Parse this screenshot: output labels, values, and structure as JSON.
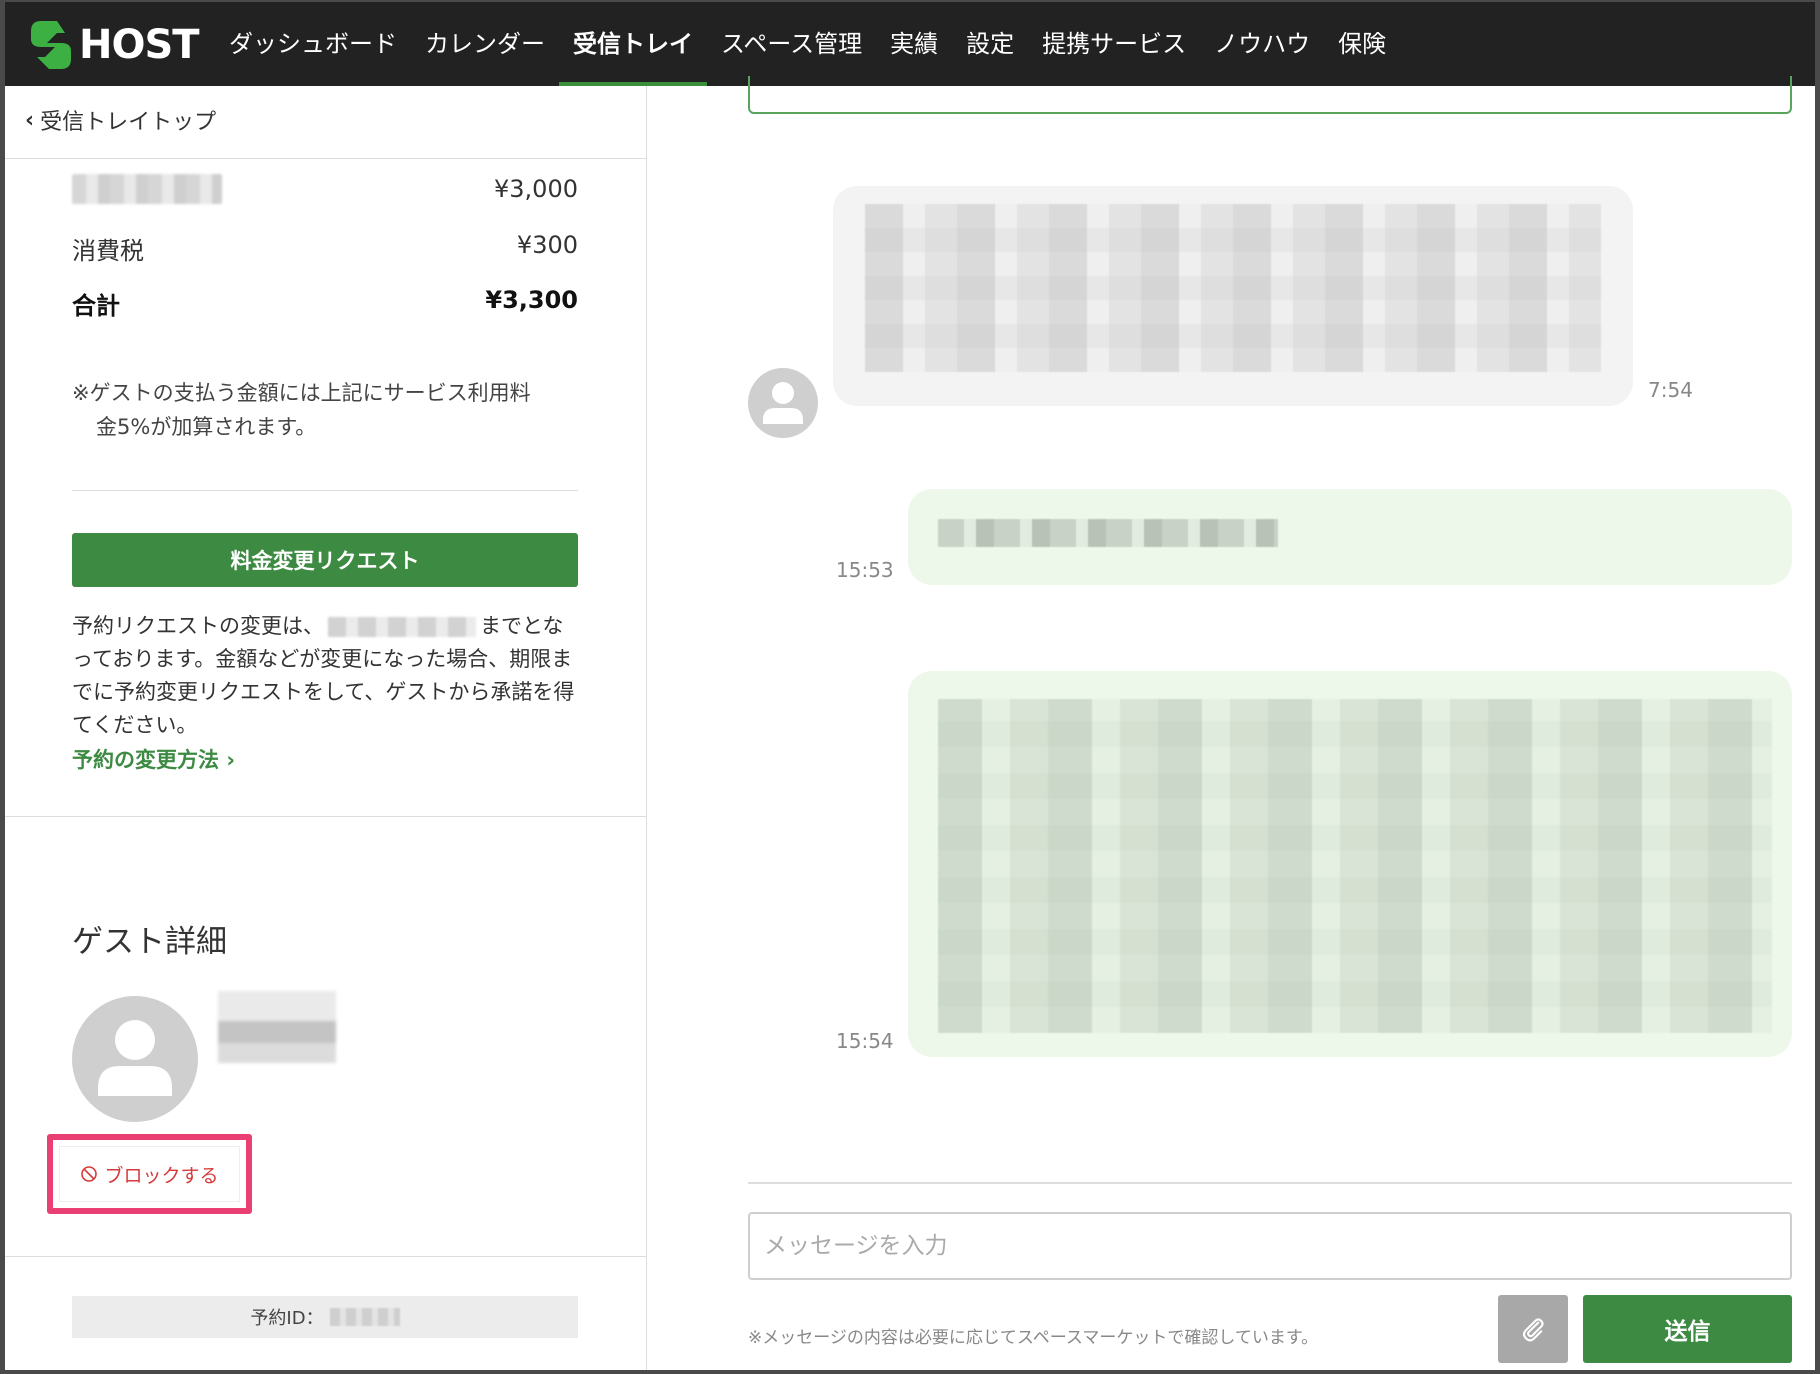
{
  "brand": {
    "logo_text": "HOST",
    "accent": "#3d8a42",
    "highlight": "#ea3f72"
  },
  "nav": {
    "items": [
      {
        "label": "ダッシュボード",
        "active": false
      },
      {
        "label": "カレンダー",
        "active": false
      },
      {
        "label": "受信トレイ",
        "active": true
      },
      {
        "label": "スペース管理",
        "active": false
      },
      {
        "label": "実績",
        "active": false
      },
      {
        "label": "設定",
        "active": false
      },
      {
        "label": "提携サービス",
        "active": false
      },
      {
        "label": "ノウハウ",
        "active": false
      },
      {
        "label": "保険",
        "active": false
      }
    ]
  },
  "left": {
    "back_label": "受信トレイトップ",
    "price_rows": {
      "base_amount": "¥3,000",
      "tax_label": "消費税",
      "tax_amount": "¥300",
      "total_label": "合計",
      "total_amount": "¥3,300"
    },
    "note_line1": "※ゲストの支払う金額には上記にサービス利用料",
    "note_line2": "金5%が加算されます。",
    "request_button": "料金変更リクエスト",
    "desc_part1": "予約リクエストの変更は、",
    "desc_part2": "までとなっております。金額などが変更になった場合、期限までに予約変更リクエストをして、ゲストから承諾を得てください。",
    "change_link": "予約の変更方法",
    "guest_section_title": "ゲスト詳細",
    "block_button": "ブロックする",
    "reservation_id_label": "予約ID："
  },
  "chat": {
    "messages": [
      {
        "direction": "incoming",
        "time": "7:54"
      },
      {
        "direction": "outgoing",
        "time": "15:53"
      },
      {
        "direction": "outgoing",
        "time": "15:54"
      }
    ],
    "input_placeholder": "メッセージを入力",
    "footer_note": "※メッセージの内容は必要に応じてスペースマーケットで確認しています。",
    "send_button": "送信"
  },
  "icons": {
    "back": "chevron-left-icon",
    "link": "chevron-right-icon",
    "block": "ban-icon",
    "attach": "paperclip-icon",
    "avatar": "user-icon"
  }
}
